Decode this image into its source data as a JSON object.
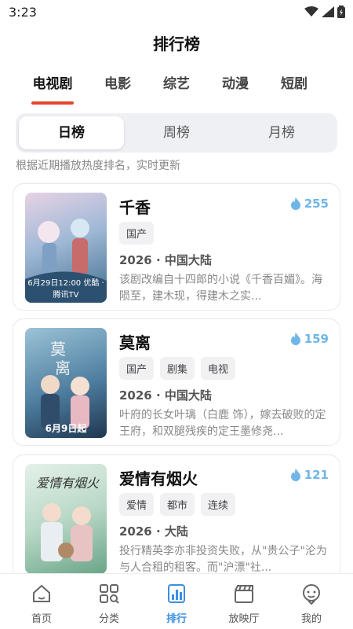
{
  "status": {
    "time": "3:23"
  },
  "page": {
    "title": "排行榜"
  },
  "categories": [
    "电视剧",
    "电影",
    "综艺",
    "动漫",
    "短剧"
  ],
  "periods": [
    "日榜",
    "周榜",
    "月榜"
  ],
  "note": "根据近期播放热度排名，实时更新",
  "items": [
    {
      "title": "千香",
      "heat": "255",
      "tags": [
        "国产"
      ],
      "meta": "2026 · 中国大陆",
      "desc": "该剧改编自十四郎的小说《千香百媚》。海陨至，建木现，得建木之实...",
      "poster_caption": "6月29日12:00 优酷 · 腾讯TV",
      "poster_colors": [
        "#c9a8c9",
        "#5f8fb0"
      ]
    },
    {
      "title": "莫离",
      "heat": "159",
      "tags": [
        "国产",
        "剧集",
        "电视"
      ],
      "meta": "2026 · 中国大陆",
      "desc": "叶府的长女叶璃（白鹿 饰），嫁去破败的定王府，和双腿残疾的定王墨修尧...",
      "poster_caption": "6月9日起",
      "poster_colors": [
        "#5a8fb0",
        "#2a4a66"
      ]
    },
    {
      "title": "爱情有烟火",
      "heat": "121",
      "tags": [
        "爱情",
        "都市",
        "连续"
      ],
      "meta": "2026 · 大陆",
      "desc": "投行精英李亦非投资失败，从\"贵公子\"沦为与人合租的租客。而\"沪漂\"社...",
      "poster_caption": "",
      "poster_colors": [
        "#cfe6d8",
        "#6aa588"
      ]
    }
  ],
  "nav": [
    "首页",
    "分类",
    "排行",
    "放映厅",
    "我的"
  ],
  "colors": {
    "accent": "#e6462e",
    "heat": "#6fb6e8",
    "nav_active": "#3b8fe0"
  }
}
